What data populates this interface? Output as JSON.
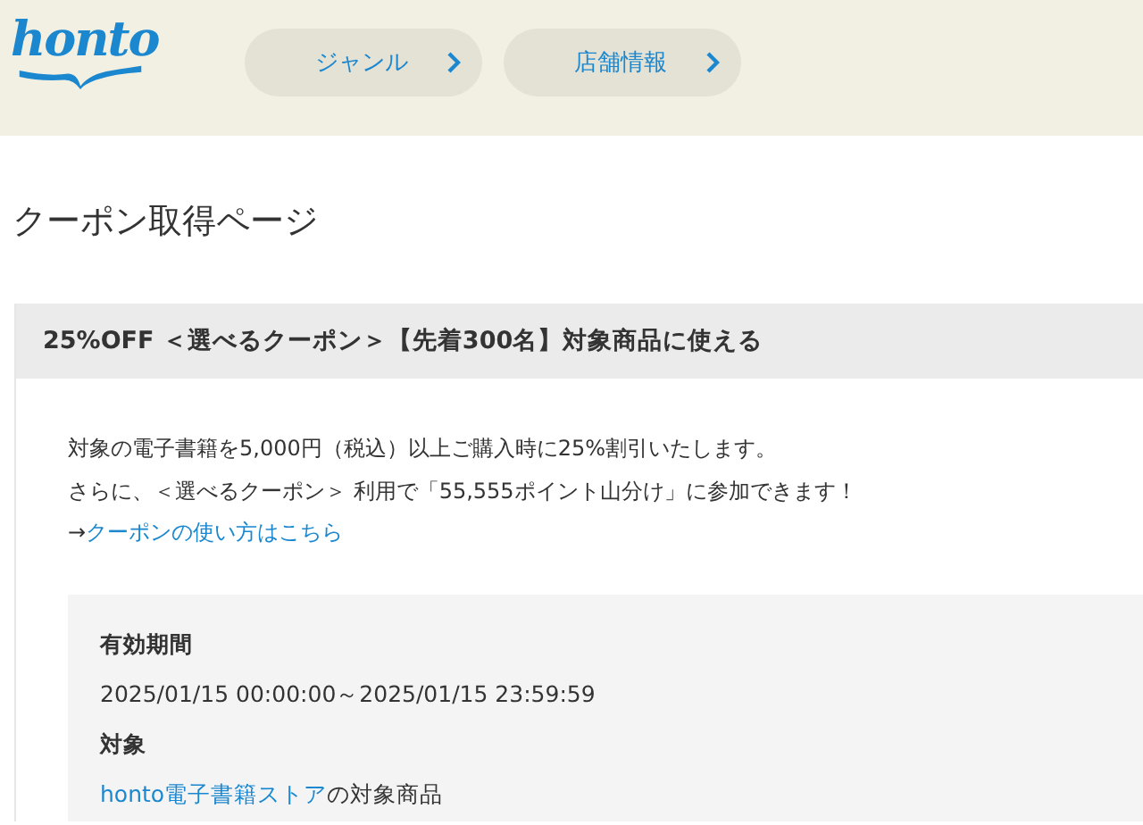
{
  "header": {
    "logo": "honto",
    "nav": [
      {
        "label": "ジャンル"
      },
      {
        "label": "店舗情報"
      }
    ]
  },
  "page_title": "クーポン取得ページ",
  "coupon": {
    "title": "25%OFF ＜選べるクーポン＞【先着300名】対象商品に使える",
    "description": [
      "対象の電子書籍を5,000円（税込）以上ご購入時に25%割引いたします。",
      "さらに、＜選べるクーポン＞ 利用で「55,555ポイント山分け」に参加できます！"
    ],
    "howto": {
      "prefix": "→",
      "link": "クーポンの使い方はこちら"
    },
    "details": [
      {
        "label": "有効期間",
        "value": "2025/01/15 00:00:00～2025/01/15 23:59:59"
      },
      {
        "label": "対象",
        "link": "honto電子書籍ストア",
        "value": "の対象商品"
      }
    ]
  }
}
